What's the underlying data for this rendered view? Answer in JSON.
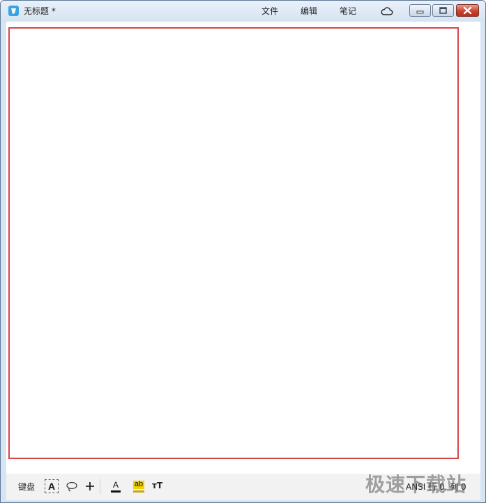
{
  "window": {
    "title": "无标题 *",
    "menu": [
      {
        "label": "文件"
      },
      {
        "label": "编辑"
      },
      {
        "label": "笔记"
      }
    ],
    "cloud_icon": "cloud-icon",
    "caption_buttons": [
      "minimize-icon",
      "maximize-icon",
      "close-icon"
    ]
  },
  "canvas": {
    "border_color": "#d94545",
    "background": "#ffffff"
  },
  "toolbar": {
    "keyboard_label": "键盘",
    "text_tool_label": "A",
    "lasso_icon": "lasso-icon",
    "add_icon": "plus-icon",
    "font_color_label": "A",
    "highlight_label": "ab",
    "font_size_label": "тT",
    "status": "ANSI 行 0, 列 0"
  },
  "watermark": "极速下载站",
  "colors": {
    "titlebar": "#d5e3f2",
    "app_icon": "#3aa3e6",
    "close_button": "#c9452f",
    "highlight": "#f2d200"
  }
}
